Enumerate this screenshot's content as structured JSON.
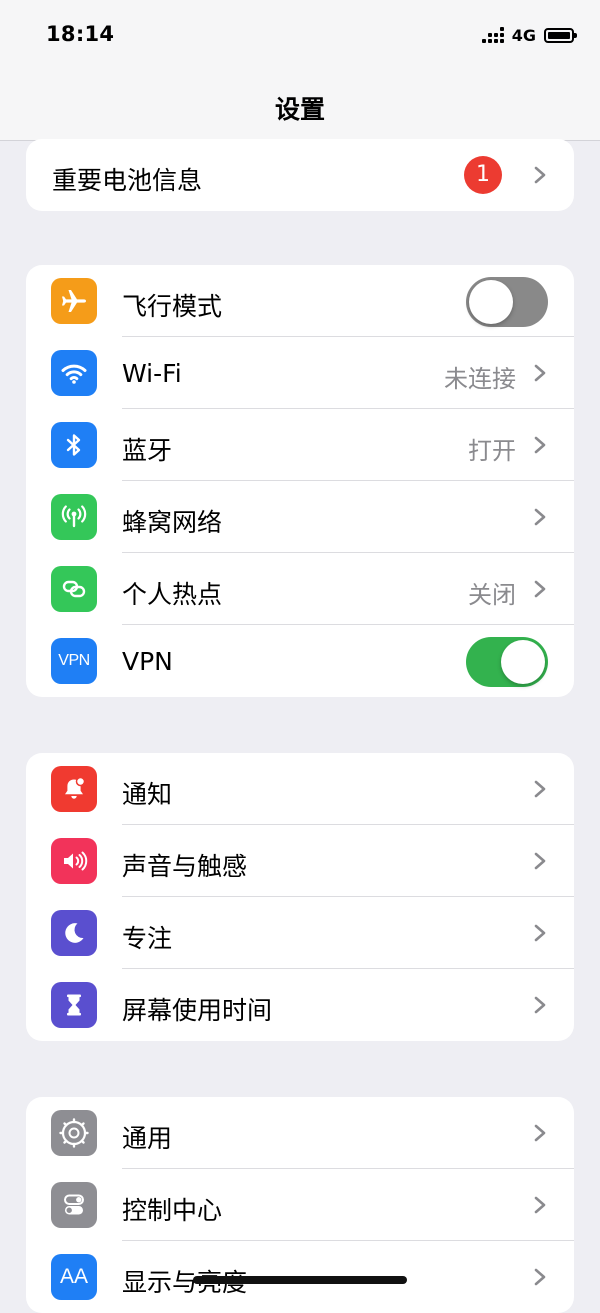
{
  "status": {
    "time": "18:14",
    "network": "4G"
  },
  "nav": {
    "title": "设置"
  },
  "battery_group": {
    "label": "重要电池信息",
    "badge": "1"
  },
  "connectivity": [
    {
      "label": "飞行模式",
      "icon": "airplane-icon",
      "color": "#f59c19",
      "toggle": "off"
    },
    {
      "label": "Wi-Fi",
      "icon": "wifi-icon",
      "color": "#1f7ff5",
      "value": "未连接"
    },
    {
      "label": "蓝牙",
      "icon": "bluetooth-icon",
      "color": "#1f7ff5",
      "value": "打开"
    },
    {
      "label": "蜂窝网络",
      "icon": "cellular-antenna-icon",
      "color": "#34c759"
    },
    {
      "label": "个人热点",
      "icon": "hotspot-link-icon",
      "color": "#34c759",
      "value": "关闭"
    },
    {
      "label": "VPN",
      "icon": "vpn-icon",
      "icon_text": "VPN",
      "color": "#1f7ff5",
      "toggle": "on"
    }
  ],
  "notifications_group": [
    {
      "label": "通知",
      "icon": "bell-icon",
      "color": "#f03a30"
    },
    {
      "label": "声音与触感",
      "icon": "speaker-icon",
      "color": "#f2335a"
    },
    {
      "label": "专注",
      "icon": "moon-icon",
      "color": "#5a4fcf"
    },
    {
      "label": "屏幕使用时间",
      "icon": "hourglass-icon",
      "color": "#5a4fcf"
    }
  ],
  "general_group": [
    {
      "label": "通用",
      "icon": "gear-icon",
      "color": "#8e8e93"
    },
    {
      "label": "控制中心",
      "icon": "toggles-icon",
      "color": "#8e8e93"
    },
    {
      "label": "显示与亮度",
      "icon": "text-size-icon",
      "icon_text": "AA",
      "color": "#1f7ff5"
    }
  ]
}
